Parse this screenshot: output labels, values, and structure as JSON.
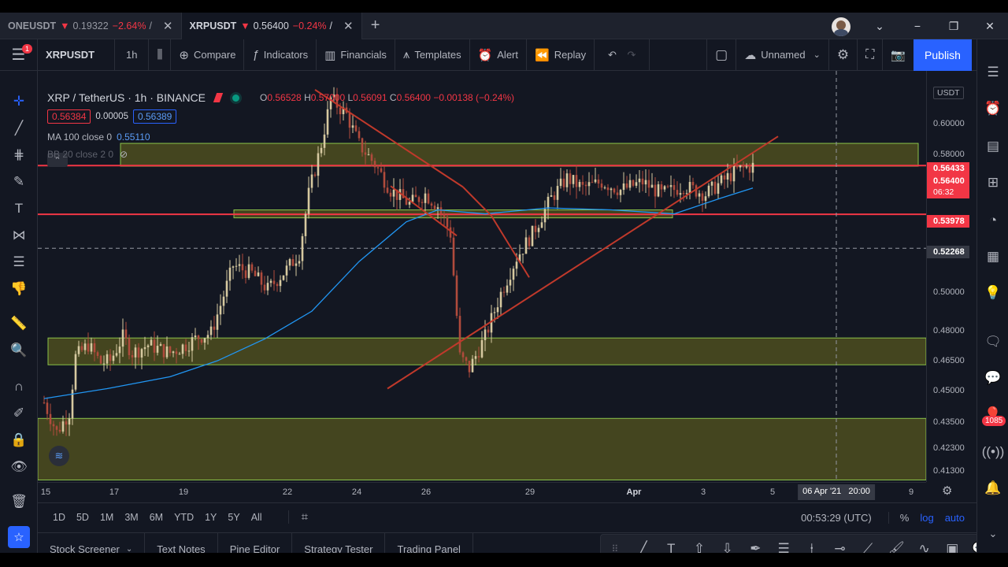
{
  "tabs": [
    {
      "symbol": "ONEUSDT",
      "arrow": "▼",
      "price": "0.19322",
      "change": "−2.64%",
      "trail": "/"
    },
    {
      "symbol": "XRPUSDT",
      "arrow": "▼",
      "price": "0.56400",
      "change": "−0.24%",
      "trail": "/"
    }
  ],
  "tab_add": "+",
  "window": {
    "minimize": "−",
    "restore": "❐",
    "close": "✕",
    "dropdown": "⌄"
  },
  "toolbar": {
    "menu_badge": "1",
    "symbol": "XRPUSDT",
    "interval": "1h",
    "compare": "Compare",
    "indicators": "Indicators",
    "financials": "Financials",
    "templates": "Templates",
    "alert": "Alert",
    "replay": "Replay",
    "layout_name": "Unnamed",
    "publish": "Publish"
  },
  "legend": {
    "title": "XRP / TetherUS · 1h · BINANCE",
    "o_label": "O",
    "o": "0.56528",
    "h_label": "H",
    "h": "0.57000",
    "l_label": "L",
    "l": "0.56091",
    "c_label": "C",
    "c": "0.56400",
    "change": "−0.00138 (−0.24%)",
    "bid": "0.56384",
    "spread": "0.00005",
    "ask": "0.56389",
    "ma": "MA 100 close 0",
    "ma_value": "0.55110",
    "bb": "BB 20 close 2 0",
    "collapse": "⌃"
  },
  "price_axis": {
    "currency": "USDT",
    "ticks": [
      "0.60000",
      "0.58000",
      "0.50000",
      "0.48000",
      "0.46500",
      "0.45000",
      "0.43500",
      "0.42300",
      "0.41300"
    ],
    "labels": {
      "high_line": "0.56433",
      "last": "0.56400",
      "countdown": "06:32",
      "support": "0.53978",
      "crosshair": "0.52268"
    }
  },
  "time_axis": {
    "ticks": [
      "15",
      "17",
      "19",
      "22",
      "24",
      "26",
      "29",
      "Apr",
      "3",
      "5",
      "9"
    ],
    "crosshair_date": "06 Apr '21",
    "crosshair_time": "20:00"
  },
  "range_bar": {
    "ranges": [
      "1D",
      "5D",
      "1M",
      "3M",
      "6M",
      "YTD",
      "1Y",
      "5Y",
      "All"
    ],
    "clock": "00:53:29 (UTC)",
    "percent": "%",
    "log": "log",
    "auto": "auto"
  },
  "bottom_panel": [
    "Stock Screener",
    "Text Notes",
    "Pine Editor",
    "Strategy Tester",
    "Trading Panel"
  ],
  "right_badge": "1085",
  "colors": {
    "background": "#131722",
    "accent": "#2962ff",
    "down": "#f23645",
    "up": "#089981",
    "zone_fill": "#4d4d1f",
    "zone_border": "#8bc34a",
    "trendline": "#c0392b",
    "ma": "#2196f3"
  },
  "chart_data": {
    "type": "candlestick",
    "symbol": "XRP / TetherUS",
    "interval": "1h",
    "exchange": "BINANCE",
    "ylim": [
      0.405,
      0.612
    ],
    "x_labels": [
      "15",
      "17",
      "19",
      "22",
      "24",
      "26",
      "29",
      "Apr",
      "3",
      "5",
      "9"
    ],
    "price_path": [
      [
        0,
        0.445
      ],
      [
        4,
        0.43
      ],
      [
        8,
        0.44
      ],
      [
        10,
        0.468
      ],
      [
        14,
        0.474
      ],
      [
        18,
        0.465
      ],
      [
        21,
        0.466
      ],
      [
        25,
        0.478
      ],
      [
        28,
        0.47
      ],
      [
        33,
        0.474
      ],
      [
        40,
        0.47
      ],
      [
        45,
        0.474
      ],
      [
        49,
        0.478
      ],
      [
        53,
        0.48
      ],
      [
        56,
        0.494
      ],
      [
        60,
        0.514
      ],
      [
        66,
        0.51
      ],
      [
        71,
        0.502
      ],
      [
        77,
        0.512
      ],
      [
        81,
        0.52
      ],
      [
        84,
        0.55
      ],
      [
        88,
        0.575
      ],
      [
        91,
        0.598
      ],
      [
        96,
        0.59
      ],
      [
        100,
        0.575
      ],
      [
        105,
        0.565
      ],
      [
        110,
        0.552
      ],
      [
        116,
        0.545
      ],
      [
        121,
        0.55
      ],
      [
        125,
        0.544
      ],
      [
        129,
        0.53
      ],
      [
        132,
        0.468
      ],
      [
        135,
        0.462
      ],
      [
        140,
        0.478
      ],
      [
        145,
        0.5
      ],
      [
        150,
        0.518
      ],
      [
        155,
        0.53
      ],
      [
        161,
        0.548
      ],
      [
        166,
        0.558
      ],
      [
        171,
        0.553
      ],
      [
        177,
        0.556
      ],
      [
        183,
        0.552
      ],
      [
        190,
        0.556
      ],
      [
        196,
        0.55
      ],
      [
        203,
        0.554
      ],
      [
        210,
        0.55
      ],
      [
        215,
        0.556
      ],
      [
        220,
        0.562
      ],
      [
        225,
        0.564
      ]
    ],
    "ma100": [
      [
        0,
        0.447
      ],
      [
        20,
        0.452
      ],
      [
        40,
        0.458
      ],
      [
        55,
        0.466
      ],
      [
        70,
        0.477
      ],
      [
        85,
        0.491
      ],
      [
        100,
        0.516
      ],
      [
        115,
        0.536
      ],
      [
        125,
        0.542
      ],
      [
        140,
        0.54
      ],
      [
        160,
        0.543
      ],
      [
        180,
        0.542
      ],
      [
        200,
        0.54
      ],
      [
        215,
        0.548
      ],
      [
        225,
        0.553
      ]
    ],
    "zones": [
      {
        "from": 0.564,
        "to": 0.5755
      },
      {
        "from": 0.538,
        "to": 0.542
      },
      {
        "from": 0.464,
        "to": 0.4775
      },
      {
        "from": 0.406,
        "to": 0.437
      }
    ],
    "horizontal_lines": [
      0.5643,
      0.5398
    ],
    "crosshair_price": 0.52268
  }
}
